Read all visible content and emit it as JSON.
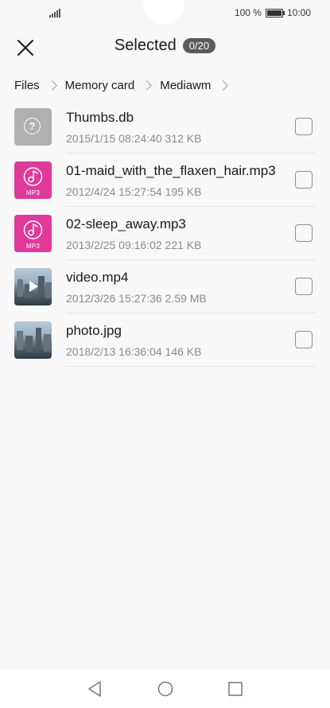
{
  "status_bar": {
    "battery_percent": "100 %",
    "time": "10:00"
  },
  "header": {
    "title": "Selected",
    "count_badge": "0/20"
  },
  "breadcrumb": [
    "Files",
    "Memory card",
    "Mediawm"
  ],
  "files": [
    {
      "name": "Thumbs.db",
      "meta": "2015/1/15 08:24:40 312 KB",
      "type": "unknown-file-icon"
    },
    {
      "name": "01-maid_with_the_flaxen_hair.mp3",
      "meta": "2012/4/24 15:27:54 195 KB",
      "type": "music-file-icon",
      "type_label": "MP3"
    },
    {
      "name": "02-sleep_away.mp3",
      "meta": "2013/2/25 09:16:02 221 KB",
      "type": "music-file-icon",
      "type_label": "MP3"
    },
    {
      "name": "video.mp4",
      "meta": "2012/3/26 15:27:36 2.59 MB",
      "type": "video-thumbnail"
    },
    {
      "name": "photo.jpg",
      "meta": "2018/2/13 16:36:04 146 KB",
      "type": "photo-thumbnail"
    }
  ],
  "colors": {
    "mp3_accent": "#e0399a",
    "unknown_file": "#b0b0b0",
    "badge": "#5a5a5a"
  }
}
